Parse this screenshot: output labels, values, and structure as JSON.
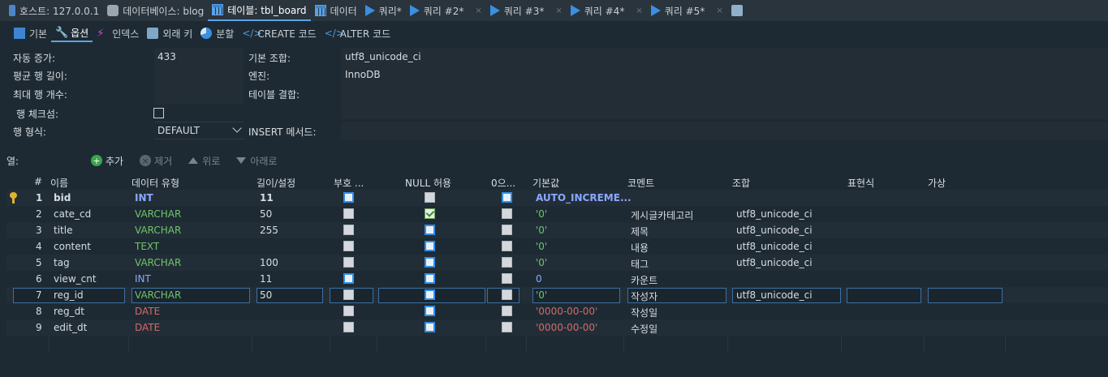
{
  "top_tabs": [
    {
      "label": "호스트: 127.0.0.1",
      "icon": "host-icon"
    },
    {
      "label": "데이터베이스: blog",
      "icon": "database-icon"
    },
    {
      "label": "테이블: tbl_board",
      "icon": "table-icon"
    },
    {
      "label": "데이터",
      "icon": "grid-icon"
    },
    {
      "label": "쿼리*",
      "icon": "play-icon"
    },
    {
      "label": "쿼리 #2*",
      "icon": "play-icon"
    },
    {
      "label": "쿼리 #3*",
      "icon": "play-icon"
    },
    {
      "label": "쿼리 #4*",
      "icon": "play-icon"
    },
    {
      "label": "쿼리 #5*",
      "icon": "play-icon"
    }
  ],
  "close_glyph": "⨯",
  "sub_tabs": [
    {
      "label": "기본",
      "icon": "table-icon"
    },
    {
      "label": "옵션",
      "icon": "wrench-icon"
    },
    {
      "label": "인덱스",
      "icon": "bolt-icon"
    },
    {
      "label": "외래 키",
      "icon": "foreign-key-icon"
    },
    {
      "label": "분할",
      "icon": "pie-icon"
    },
    {
      "label": "CREATE 코드",
      "icon": "code-icon"
    },
    {
      "label": "ALTER 코드",
      "icon": "code-icon"
    }
  ],
  "options": {
    "auto_increment_label": "자동 증가:",
    "auto_increment_value": "433",
    "avg_row_length_label": "평균 행 길이:",
    "max_rows_label": "최대 행 개수:",
    "row_checksum_label": "행 체크섬:",
    "row_format_label": "행 형식:",
    "row_format_value": "DEFAULT",
    "collation_label": "기본 조합:",
    "collation_value": "utf8_unicode_ci",
    "engine_label": "엔진:",
    "engine_value": "InnoDB",
    "union_label": "테이블 결합:",
    "insert_method_label": "INSERT 메서드:"
  },
  "columns_toolbar": {
    "label": "열:",
    "add": "추가",
    "remove": "제거",
    "up": "위로",
    "down": "아래로"
  },
  "grid": {
    "headers": [
      "#",
      "이름",
      "데이터 유형",
      "길이/설정",
      "부호 ...",
      "NULL 허용",
      "0으...",
      "기본값",
      "코멘트",
      "조합",
      "표현식",
      "가상"
    ],
    "rows": [
      {
        "num": "1",
        "name": "bid",
        "type": "INT",
        "length": "11",
        "unsigned": true,
        "nullable": false,
        "zerofill": true,
        "default": "AUTO_INCREME...",
        "comment": "",
        "collation": "",
        "primary": true
      },
      {
        "num": "2",
        "name": "cate_cd",
        "type": "VARCHAR",
        "length": "50",
        "unsigned": false,
        "nullable": "checked",
        "zerofill": false,
        "default": "'0'",
        "comment": "게시글카테고리",
        "collation": "utf8_unicode_ci"
      },
      {
        "num": "3",
        "name": "title",
        "type": "VARCHAR",
        "length": "255",
        "unsigned": false,
        "nullable": true,
        "zerofill": false,
        "default": "'0'",
        "comment": "제목",
        "collation": "utf8_unicode_ci"
      },
      {
        "num": "4",
        "name": "content",
        "type": "TEXT",
        "length": "",
        "unsigned": false,
        "nullable": true,
        "zerofill": false,
        "default": "'0'",
        "comment": "내용",
        "collation": "utf8_unicode_ci"
      },
      {
        "num": "5",
        "name": "tag",
        "type": "VARCHAR",
        "length": "100",
        "unsigned": false,
        "nullable": true,
        "zerofill": false,
        "default": "'0'",
        "comment": "태그",
        "collation": "utf8_unicode_ci"
      },
      {
        "num": "6",
        "name": "view_cnt",
        "type": "INT",
        "length": "11",
        "unsigned": true,
        "nullable": true,
        "zerofill": false,
        "default": "0",
        "comment": "카운트",
        "collation": ""
      },
      {
        "num": "7",
        "name": "reg_id",
        "type": "VARCHAR",
        "length": "50",
        "unsigned": false,
        "nullable": true,
        "zerofill": false,
        "default": "'0'",
        "comment": "작성자",
        "collation": "utf8_unicode_ci",
        "editing": true
      },
      {
        "num": "8",
        "name": "reg_dt",
        "type": "DATE",
        "length": "",
        "unsigned": false,
        "nullable": true,
        "zerofill": false,
        "default": "'0000-00-00'",
        "comment": "작성일",
        "collation": ""
      },
      {
        "num": "9",
        "name": "edit_dt",
        "type": "DATE",
        "length": "",
        "unsigned": false,
        "nullable": true,
        "zerofill": false,
        "default": "'0000-00-00'",
        "comment": "수정일",
        "collation": ""
      }
    ]
  }
}
